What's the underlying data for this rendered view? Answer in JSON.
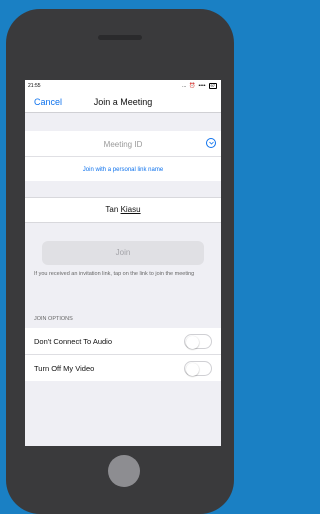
{
  "status_bar": {
    "time": "21:55",
    "icons": "...",
    "battery": "97"
  },
  "nav": {
    "cancel_label": "Cancel",
    "title": "Join a Meeting"
  },
  "meeting_id": {
    "placeholder": "Meeting ID",
    "dropdown_icon": "chevron-down-circle-icon"
  },
  "personal_link_label": "Join with a personal link name",
  "name": {
    "first": "Tan",
    "last": "Kiasu"
  },
  "join_button_label": "Join",
  "hint_text": "If you received an invitation link, tap on the link to join the meeting",
  "join_options": {
    "label": "JOIN OPTIONS",
    "items": [
      {
        "label": "Don't Connect To Audio",
        "enabled": false
      },
      {
        "label": "Turn Off My Video",
        "enabled": false
      }
    ]
  },
  "colors": {
    "accent": "#0e72ed",
    "background": "#1a80c4",
    "phone_body": "#3a3a3c"
  }
}
